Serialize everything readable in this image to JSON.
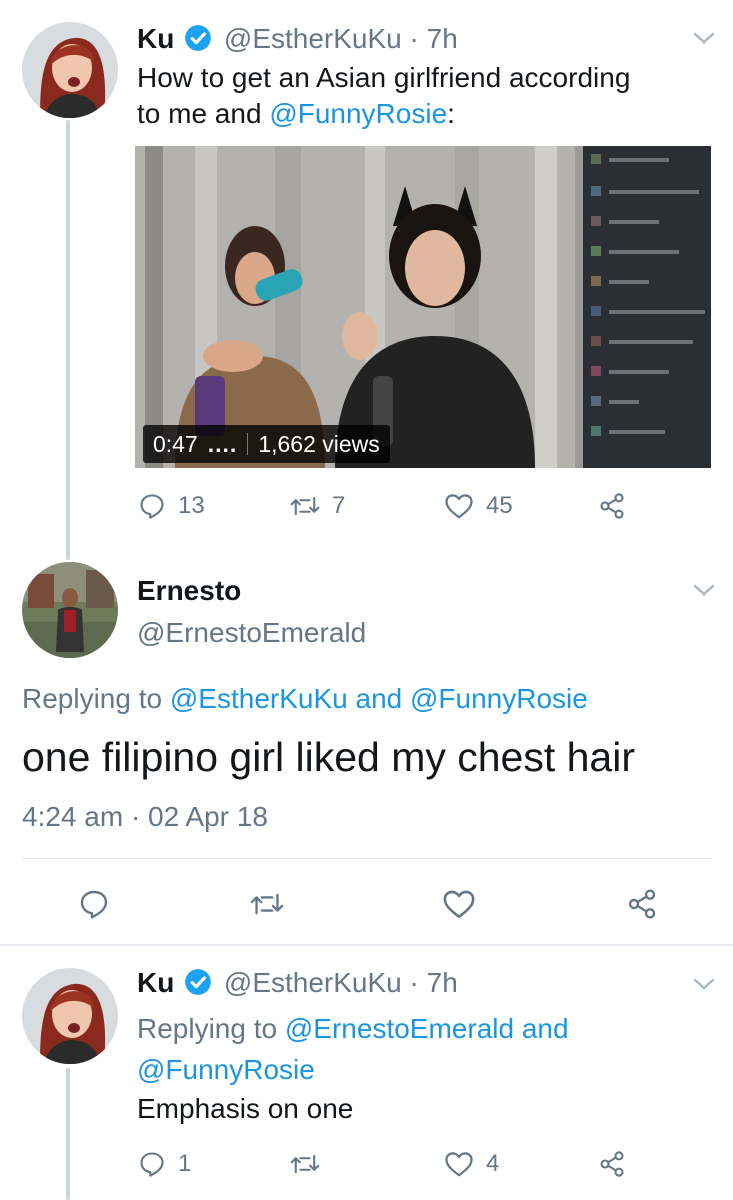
{
  "tweet1": {
    "name": "Ku",
    "handle": "@EstherKuKu",
    "sep": "·",
    "time": "7h",
    "text_line1": "How to get an Asian girlfriend according",
    "text_line2_prefix": "to me and ",
    "text_line2_mention": "@FunnyRosie",
    "text_line2_suffix": ":",
    "video": {
      "duration": "0:47",
      "dots": "....",
      "views": "1,662 views"
    },
    "actions": {
      "replies": "13",
      "retweets": "7",
      "likes": "45"
    }
  },
  "tweet2": {
    "name": "Ernesto",
    "handle": "@ErnestoEmerald",
    "replying_prefix": "Replying to ",
    "replying_mention1": "@EstherKuKu",
    "replying_and": " and ",
    "replying_mention2": "@FunnyRosie",
    "text": "one filipino girl liked my chest hair",
    "timestamp": "4:24 am · 02 Apr 18"
  },
  "tweet3": {
    "name": "Ku",
    "handle": "@EstherKuKu",
    "sep": "·",
    "time": "7h",
    "replying_prefix": "Replying to ",
    "replying_mention1": "@ErnestoEmerald",
    "replying_and": " and",
    "replying_mention2": "@FunnyRosie",
    "text": "Emphasis on one",
    "actions": {
      "replies": "1",
      "likes": "4"
    }
  },
  "colors": {
    "link": "#1b95e0",
    "muted": "#657786",
    "verified": "#1da1f2",
    "text": "#14171a"
  },
  "icons": [
    "verified-badge-icon",
    "chevron-down-icon",
    "reply-icon",
    "retweet-icon",
    "like-icon",
    "share-icon"
  ]
}
